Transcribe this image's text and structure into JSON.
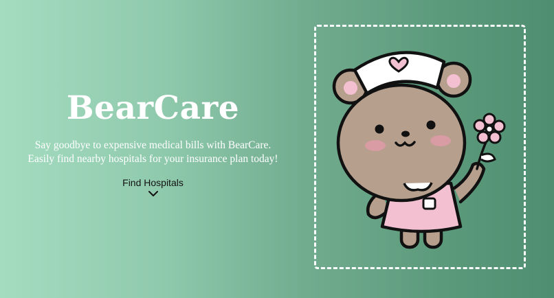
{
  "hero": {
    "title": "BearCare",
    "tagline_line1": "Say goodbye to expensive medical bills with BearCare.",
    "tagline_line2": "Easily find nearby hospitals for your insurance plan today!",
    "cta_label": "Find Hospitals",
    "cta_icon": "chevron-down-icon"
  },
  "illustration": {
    "subject": "nurse-bear-icon"
  },
  "colors": {
    "gradient_start": "#a4dcc0",
    "gradient_end": "#4f8e70",
    "title": "#ffffff",
    "bear_fur": "#b79f8d",
    "dress": "#f3c0d2",
    "blush": "#d99ba4"
  }
}
